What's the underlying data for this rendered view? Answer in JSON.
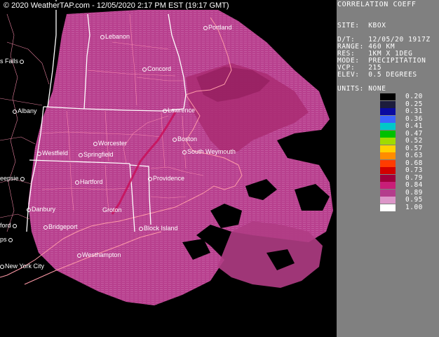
{
  "copyright": "© 2020 WeatherTAP.com - 12/05/2020  2:17 PM EST (19:17 GMT)",
  "panel": {
    "product": "CORRELATION COEFF",
    "site": "SITE:  KBOX",
    "dt": "D/T:   12/05/20 1917Z",
    "range": "RANGE: 460 KM",
    "res": "RES:   1KM X 1DEG",
    "mode": "MODE:  PRECIPITATION",
    "vcp": "VCP:   215",
    "elev": "ELEV:  0.5 DEGREES",
    "units": "UNITS: NONE"
  },
  "legend": [
    {
      "value": "0.20",
      "color": "#000000"
    },
    {
      "value": "0.25",
      "color": "#1c1c3c"
    },
    {
      "value": "0.31",
      "color": "#0a0aa0"
    },
    {
      "value": "0.36",
      "color": "#3c64ff"
    },
    {
      "value": "0.41",
      "color": "#00c8c8"
    },
    {
      "value": "0.47",
      "color": "#00c000"
    },
    {
      "value": "0.52",
      "color": "#a0dc00"
    },
    {
      "value": "0.57",
      "color": "#ffd200"
    },
    {
      "value": "0.63",
      "color": "#ff8c00"
    },
    {
      "value": "0.68",
      "color": "#ff3c00"
    },
    {
      "value": "0.73",
      "color": "#d20000"
    },
    {
      "value": "0.79",
      "color": "#a0003c"
    },
    {
      "value": "0.84",
      "color": "#c81e78"
    },
    {
      "value": "0.89",
      "color": "#b43c8c"
    },
    {
      "value": "0.95",
      "color": "#dc96c8"
    },
    {
      "value": "1.00",
      "color": "#ffffff"
    }
  ],
  "cities": [
    {
      "name": "Lebanon"
    },
    {
      "name": "Portland"
    },
    {
      "name": "s Falls"
    },
    {
      "name": "Concord"
    },
    {
      "name": "Albany"
    },
    {
      "name": "Lawrence"
    },
    {
      "name": "Worcester"
    },
    {
      "name": "Boston"
    },
    {
      "name": "Westfield"
    },
    {
      "name": "Springfield"
    },
    {
      "name": "South Weymouth"
    },
    {
      "name": "Hartford"
    },
    {
      "name": "Providence"
    },
    {
      "name": "eepsie"
    },
    {
      "name": "Danbury"
    },
    {
      "name": "Groton"
    },
    {
      "name": "Block Island"
    },
    {
      "name": "Bridgeport"
    },
    {
      "name": "ford"
    },
    {
      "name": "Westhampton"
    },
    {
      "name": "ps"
    },
    {
      "name": "New York City"
    }
  ]
}
